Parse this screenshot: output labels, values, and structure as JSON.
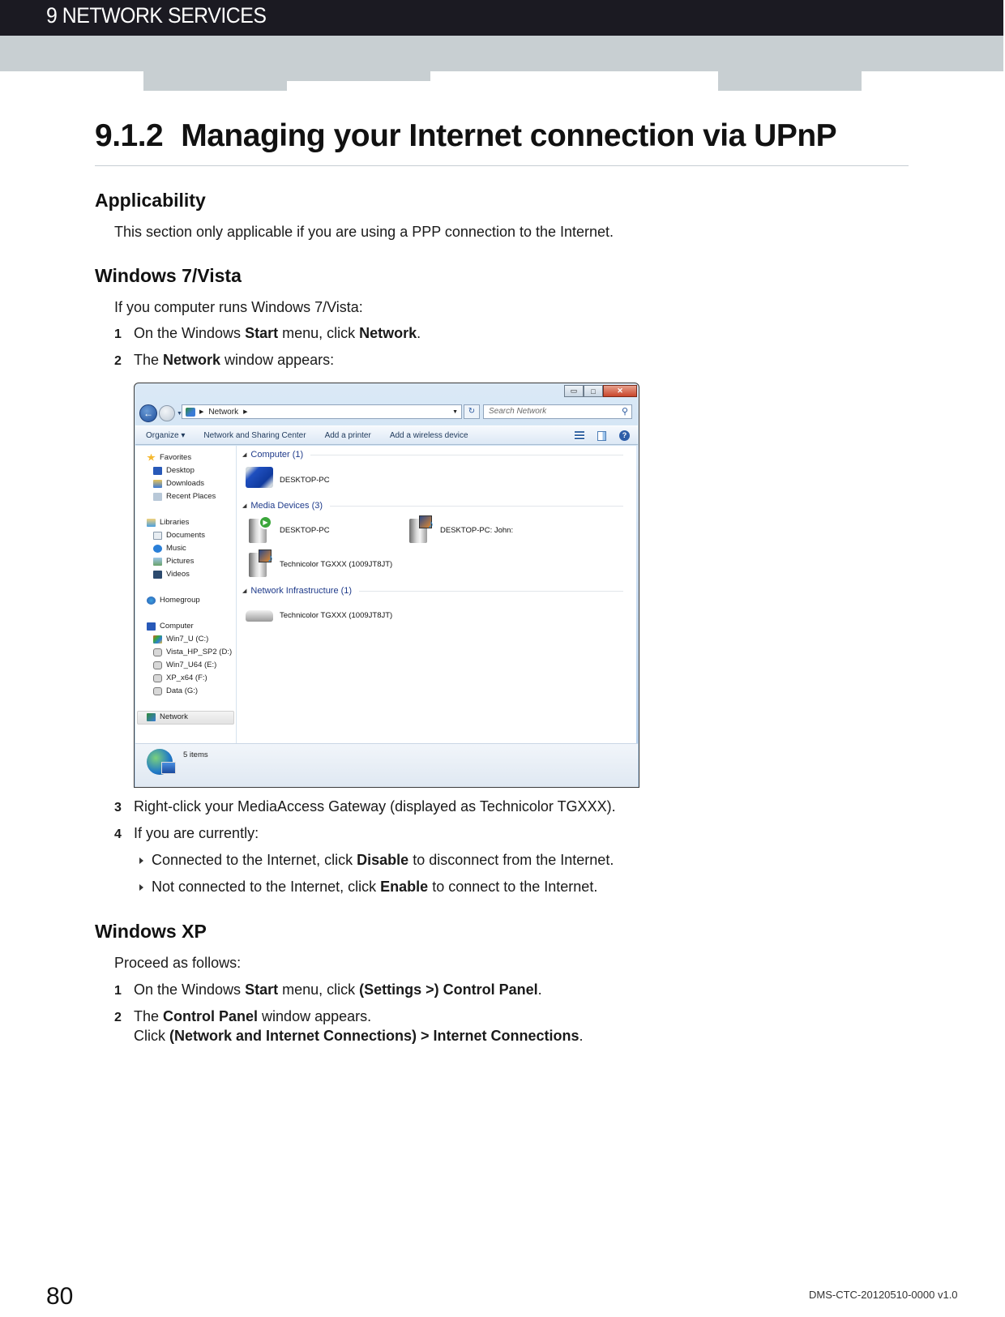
{
  "header": {
    "chapter": "9 NETWORK SERVICES"
  },
  "section": {
    "number": "9.1.2",
    "title": "Managing your Internet connection via UPnP"
  },
  "applicability": {
    "heading": "Applicability",
    "text": "This section only applicable if you are using a PPP connection to the Internet."
  },
  "win7": {
    "heading": "Windows 7/Vista",
    "intro": "If you computer runs Windows 7/Vista:",
    "steps": [
      {
        "n": "1",
        "pre": "On the Windows ",
        "b1": "Start",
        "mid": " menu, click ",
        "b2": "Network",
        "post": "."
      },
      {
        "n": "2",
        "pre": "The ",
        "b1": "Network",
        "post": " window appears:"
      },
      {
        "n": "3",
        "text": "Right-click your MediaAccess Gateway (displayed as Technicolor TGXXX)."
      },
      {
        "n": "4",
        "text": "If you are currently:"
      }
    ],
    "bullets": [
      {
        "pre": "Connected to the Internet, click ",
        "b": "Disable",
        "post": " to disconnect from the Internet."
      },
      {
        "pre": "Not connected to the Internet, click ",
        "b": "Enable",
        "post": " to connect to the Internet."
      }
    ]
  },
  "screenshot": {
    "window_controls": {
      "minimize": "▭",
      "maximize": "□",
      "close": "✕"
    },
    "address": {
      "icon": "network-icon",
      "path": "Network"
    },
    "search_placeholder": "Search Network",
    "toolbar": [
      "Organize ▾",
      "Network and Sharing Center",
      "Add a printer",
      "Add a wireless device"
    ],
    "sidebar": {
      "favorites": {
        "label": "Favorites",
        "items": [
          "Desktop",
          "Downloads",
          "Recent Places"
        ]
      },
      "libraries": {
        "label": "Libraries",
        "items": [
          "Documents",
          "Music",
          "Pictures",
          "Videos"
        ]
      },
      "homegroup": "Homegroup",
      "computer": {
        "label": "Computer",
        "items": [
          "Win7_U (C:)",
          "Vista_HP_SP2 (D:)",
          "Win7_U64 (E:)",
          "XP_x64 (F:)",
          "Data (G:)"
        ]
      },
      "network": "Network"
    },
    "groups": [
      {
        "label": "Computer (1)",
        "items": [
          "DESKTOP-PC"
        ]
      },
      {
        "label": "Media Devices (3)",
        "items": [
          "DESKTOP-PC",
          "DESKTOP-PC: John:",
          "Technicolor TGXXX (1009JT8JT)"
        ]
      },
      {
        "label": "Network Infrastructure (1)",
        "items": [
          "Technicolor TGXXX (1009JT8JT)"
        ]
      }
    ],
    "status": "5 items"
  },
  "winxp": {
    "heading": "Windows XP",
    "intro": "Proceed as follows:",
    "steps": [
      {
        "n": "1",
        "pre": "On the Windows ",
        "b1": "Start",
        "mid": " menu, click ",
        "b2": "(Settings >) Control Panel",
        "post": "."
      },
      {
        "n": "2",
        "pre": "The ",
        "b1": "Control Panel",
        "post": " window appears.",
        "line2_pre": "Click ",
        "line2_b": "(Network and Internet Connections) > Internet Connections",
        "line2_post": "."
      }
    ]
  },
  "footer": {
    "page": "80",
    "doc_id": "DMS-CTC-20120510-0000 v1.0"
  }
}
